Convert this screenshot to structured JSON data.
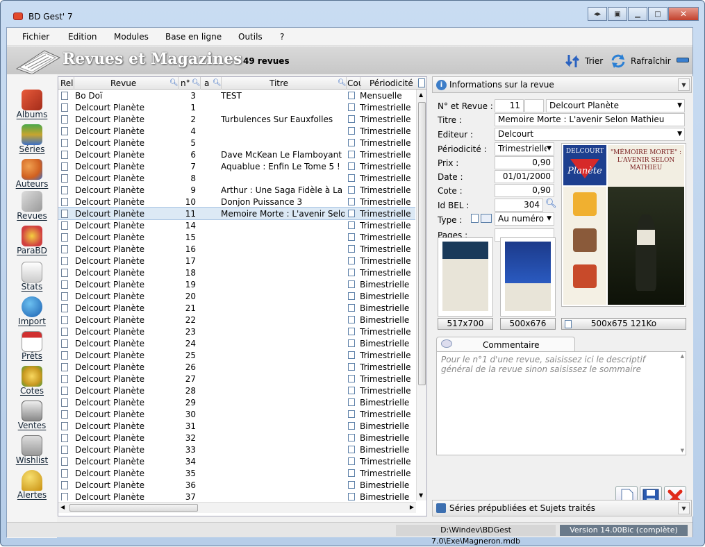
{
  "window": {
    "title": "BD Gest' 7"
  },
  "menu": [
    "Fichier",
    "Edition",
    "Modules",
    "Base en ligne",
    "Outils",
    "?"
  ],
  "header": {
    "title": "Revues et Magazines",
    "count": "49 revues",
    "sort_label": "Trier",
    "refresh_label": "Rafraîchir"
  },
  "sidebar": [
    {
      "label": "Albums",
      "icon": "albums-icon"
    },
    {
      "label": "Séries",
      "icon": "series-icon"
    },
    {
      "label": "Auteurs",
      "icon": "authors-icon"
    },
    {
      "label": "Revues",
      "icon": "magazines-icon"
    },
    {
      "label": "ParaBD",
      "icon": "parabd-icon"
    },
    {
      "label": "Stats",
      "icon": "stats-icon"
    },
    {
      "label": "Import",
      "icon": "import-icon"
    },
    {
      "label": "Prêts",
      "icon": "loans-icon"
    },
    {
      "label": "Cotes",
      "icon": "ratings-icon"
    },
    {
      "label": "Ventes",
      "icon": "sales-icon"
    },
    {
      "label": "Wishlist",
      "icon": "wishlist-icon"
    },
    {
      "label": "Alertes",
      "icon": "alerts-icon"
    }
  ],
  "grid": {
    "columns": [
      "Reli",
      "Revue",
      "n°",
      "a",
      "Titre",
      "Cou",
      "Périodicité"
    ],
    "rows": [
      {
        "revue": "Bo Doï",
        "num": "3",
        "titre": "TEST",
        "periodicite": "Mensuelle"
      },
      {
        "revue": "Delcourt Planète",
        "num": "1",
        "titre": "",
        "periodicite": "Trimestrielle"
      },
      {
        "revue": "Delcourt Planète",
        "num": "2",
        "titre": "Turbulences Sur Eauxfolles",
        "periodicite": "Trimestrielle"
      },
      {
        "revue": "Delcourt Planète",
        "num": "4",
        "titre": "",
        "periodicite": "Trimestrielle"
      },
      {
        "revue": "Delcourt Planète",
        "num": "5",
        "titre": "",
        "periodicite": "Trimestrielle"
      },
      {
        "revue": "Delcourt Planète",
        "num": "6",
        "titre": "Dave McKean Le Flamboyant",
        "periodicite": "Trimestrielle"
      },
      {
        "revue": "Delcourt Planète",
        "num": "7",
        "titre": "Aquablue : Enfin Le Tome 5 !",
        "periodicite": "Trimestrielle"
      },
      {
        "revue": "Delcourt Planète",
        "num": "8",
        "titre": "",
        "periodicite": "Trimestrielle"
      },
      {
        "revue": "Delcourt Planète",
        "num": "9",
        "titre": "Arthur : Une Saga Fidèle à La L",
        "periodicite": "Trimestrielle"
      },
      {
        "revue": "Delcourt Planète",
        "num": "10",
        "titre": "Donjon Puissance 3",
        "periodicite": "Trimestrielle"
      },
      {
        "revue": "Delcourt Planète",
        "num": "11",
        "titre": "Memoire Morte : L'avenir Selon",
        "periodicite": "Trimestrielle",
        "selected": true
      },
      {
        "revue": "Delcourt Planète",
        "num": "14",
        "titre": "",
        "periodicite": "Trimestrielle"
      },
      {
        "revue": "Delcourt Planète",
        "num": "15",
        "titre": "",
        "periodicite": "Trimestrielle"
      },
      {
        "revue": "Delcourt Planète",
        "num": "16",
        "titre": "",
        "periodicite": "Trimestrielle"
      },
      {
        "revue": "Delcourt Planète",
        "num": "17",
        "titre": "",
        "periodicite": "Trimestrielle"
      },
      {
        "revue": "Delcourt Planète",
        "num": "18",
        "titre": "",
        "periodicite": "Trimestrielle"
      },
      {
        "revue": "Delcourt Planète",
        "num": "19",
        "titre": "",
        "periodicite": "Bimestrielle"
      },
      {
        "revue": "Delcourt Planète",
        "num": "20",
        "titre": "",
        "periodicite": "Bimestrielle"
      },
      {
        "revue": "Delcourt Planète",
        "num": "21",
        "titre": "",
        "periodicite": "Bimestrielle"
      },
      {
        "revue": "Delcourt Planète",
        "num": "22",
        "titre": "",
        "periodicite": "Bimestrielle"
      },
      {
        "revue": "Delcourt Planète",
        "num": "23",
        "titre": "",
        "periodicite": "Trimestrielle"
      },
      {
        "revue": "Delcourt Planète",
        "num": "24",
        "titre": "",
        "periodicite": "Bimestrielle"
      },
      {
        "revue": "Delcourt Planète",
        "num": "25",
        "titre": "",
        "periodicite": "Trimestrielle"
      },
      {
        "revue": "Delcourt Planète",
        "num": "26",
        "titre": "",
        "periodicite": "Trimestrielle"
      },
      {
        "revue": "Delcourt Planète",
        "num": "27",
        "titre": "",
        "periodicite": "Trimestrielle"
      },
      {
        "revue": "Delcourt Planète",
        "num": "28",
        "titre": "",
        "periodicite": "Trimestrielle"
      },
      {
        "revue": "Delcourt Planète",
        "num": "29",
        "titre": "",
        "periodicite": "Bimestrielle"
      },
      {
        "revue": "Delcourt Planète",
        "num": "30",
        "titre": "",
        "periodicite": "Trimestrielle"
      },
      {
        "revue": "Delcourt Planète",
        "num": "31",
        "titre": "",
        "periodicite": "Bimestrielle"
      },
      {
        "revue": "Delcourt Planète",
        "num": "32",
        "titre": "",
        "periodicite": "Bimestrielle"
      },
      {
        "revue": "Delcourt Planète",
        "num": "33",
        "titre": "",
        "periodicite": "Bimestrielle"
      },
      {
        "revue": "Delcourt Planète",
        "num": "34",
        "titre": "",
        "periodicite": "Trimestrielle"
      },
      {
        "revue": "Delcourt Planète",
        "num": "35",
        "titre": "",
        "periodicite": "Trimestrielle"
      },
      {
        "revue": "Delcourt Planète",
        "num": "36",
        "titre": "",
        "periodicite": "Bimestrielle"
      },
      {
        "revue": "Delcourt Planète",
        "num": "37",
        "titre": "",
        "periodicite": "Bimestrielle"
      }
    ]
  },
  "info": {
    "header": "Informations sur la revue",
    "num_label": "N° et Revue :",
    "num_value": "11",
    "num_suffix": "",
    "revue_value": "Delcourt Planète",
    "titre_label": "Titre :",
    "titre_value": "Memoire Morte : L'avenir Selon Mathieu",
    "editeur_label": "Editeur :",
    "editeur_value": "Delcourt",
    "periodicite_label": "Périodicité :",
    "periodicite_value": "Trimestrielle",
    "prix_label": "Prix :",
    "prix_value": "0,90",
    "date_label": "Date :",
    "date_value": "01/01/2000",
    "cote_label": "Cote :",
    "cote_value": "0,90",
    "idbel_label": "Id BEL :",
    "idbel_value": "304",
    "type_label": "Type :",
    "type_value": "Au numéro",
    "pages_label": "Pages :",
    "pages_value": "",
    "img1_size": "517x700",
    "img2_size": "500x676",
    "img3_size": "500x675 121Ko",
    "cover_brand": "DELCOURT",
    "cover_brand2": "Planète",
    "cover_title": "\"MÉMOIRE MORTE\" : L'AVENIR SELON MATHIEU",
    "comment_tab": "Commentaire",
    "comment_placeholder": "Pour le n°1 d'une revue, saisissez ici le descriptif général de la revue sinon saisissez le sommaire",
    "series_header": "Séries prépubliées et Sujets traités"
  },
  "status": {
    "path": "D:\\Windev\\BDGest 7.0\\Exe\\Magneron.mdb",
    "version": "Version 14.00Bic (complète)"
  },
  "colors": {
    "accent": "#2a62c0",
    "selected_row": "#dce9f5",
    "header_bg": "#c7c7c7"
  }
}
